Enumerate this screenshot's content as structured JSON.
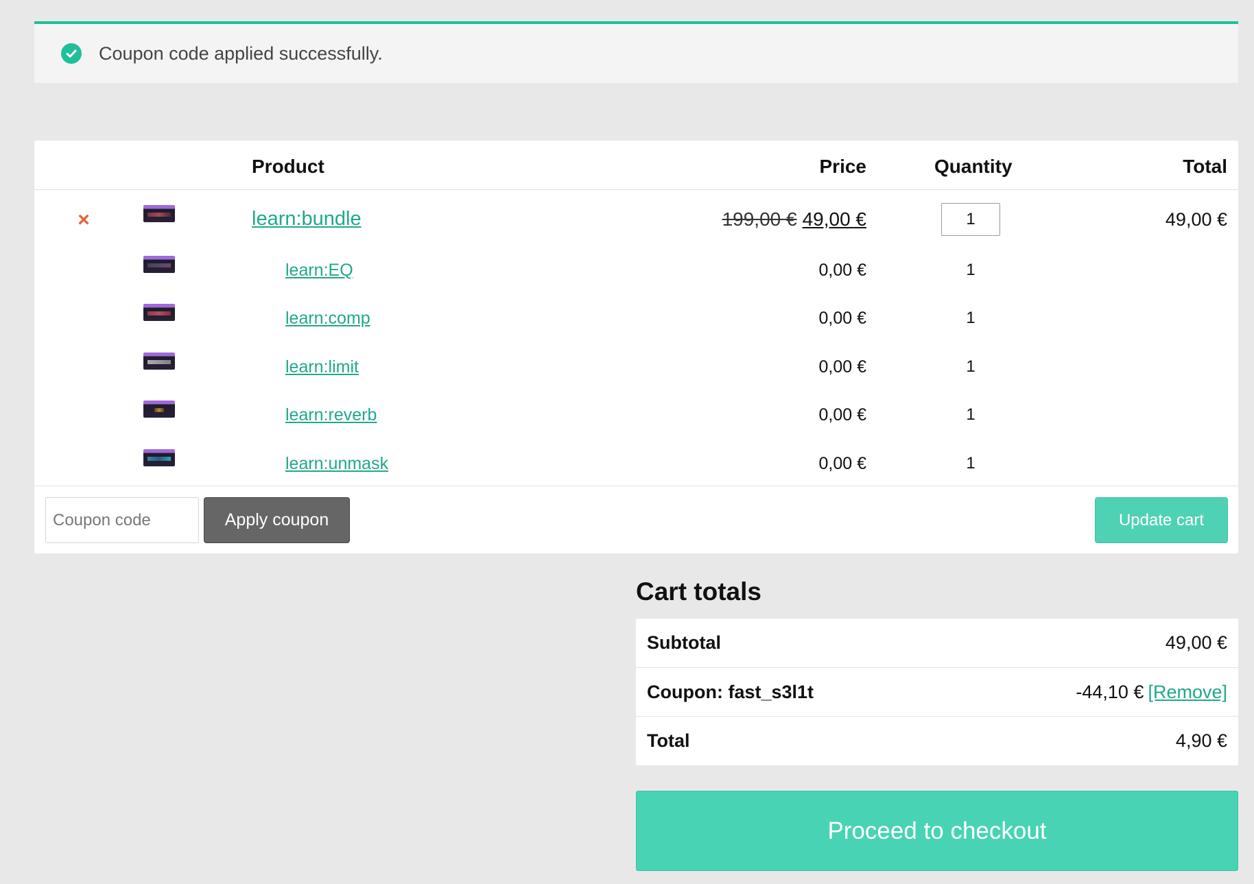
{
  "notice": {
    "message": "Coupon code applied successfully."
  },
  "table": {
    "headers": {
      "product": "Product",
      "price": "Price",
      "quantity": "Quantity",
      "total": "Total"
    },
    "bundle": {
      "name": "learn:bundle",
      "old_price": "199,00 €",
      "price": "49,00 €",
      "quantity": "1",
      "total": "49,00 €"
    },
    "items": [
      {
        "name": "learn:EQ",
        "price": "0,00 €",
        "quantity": "1"
      },
      {
        "name": "learn:comp",
        "price": "0,00 €",
        "quantity": "1"
      },
      {
        "name": "learn:limit",
        "price": "0,00 €",
        "quantity": "1"
      },
      {
        "name": "learn:reverb",
        "price": "0,00 €",
        "quantity": "1"
      },
      {
        "name": "learn:unmask",
        "price": "0,00 €",
        "quantity": "1"
      }
    ]
  },
  "actions": {
    "coupon_placeholder": "Coupon code",
    "apply_label": "Apply coupon",
    "update_label": "Update cart"
  },
  "totals": {
    "title": "Cart totals",
    "subtotal_label": "Subtotal",
    "subtotal": "49,00 €",
    "coupon_label": "Coupon: fast_s3l1t",
    "coupon_value": "-44,10 €",
    "remove_label": "[Remove]",
    "total_label": "Total",
    "total": "4,90 €"
  },
  "checkout": {
    "label": "Proceed to checkout"
  },
  "colors": {
    "accent": "#1fbf9b",
    "button_teal": "#48d3b4",
    "remove_x": "#e8603c"
  }
}
